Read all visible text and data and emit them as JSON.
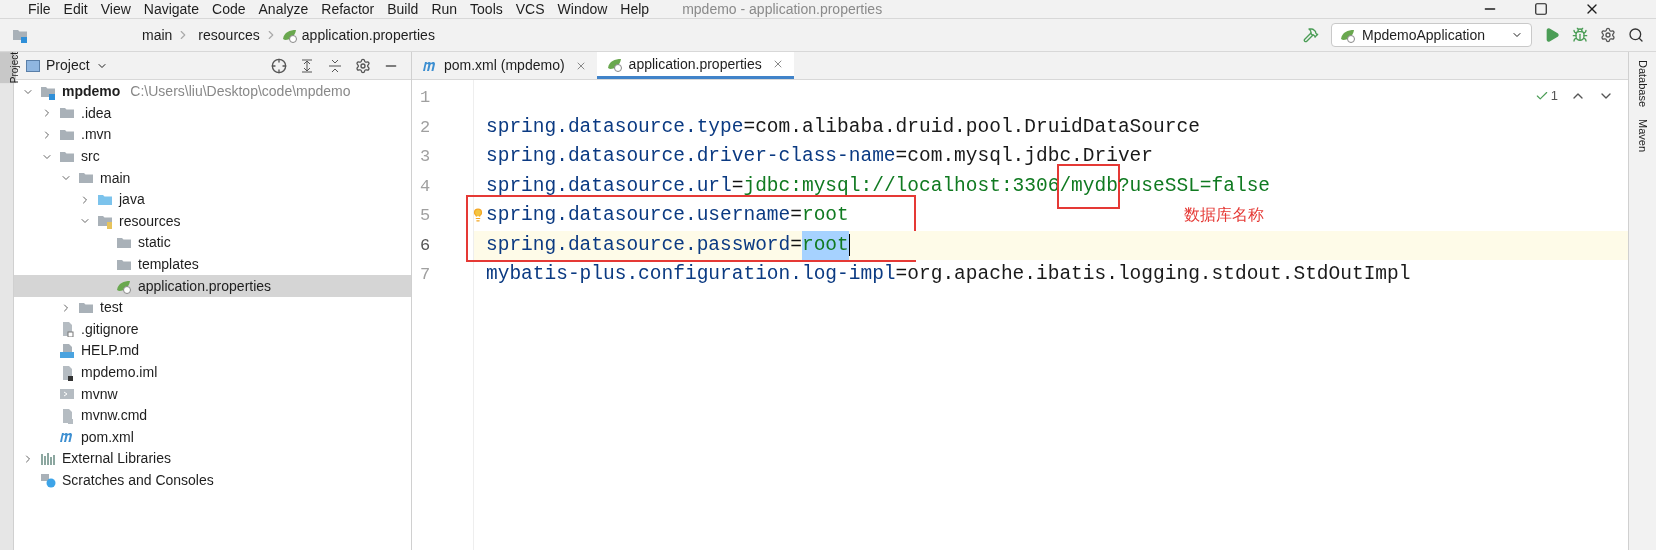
{
  "menu": [
    "File",
    "Edit",
    "View",
    "Navigate",
    "Code",
    "Analyze",
    "Refactor",
    "Build",
    "Run",
    "Tools",
    "VCS",
    "Window",
    "Help"
  ],
  "window": {
    "title": "mpdemo - application.properties"
  },
  "breadcrumbs": [
    "main",
    "resources",
    "application.properties"
  ],
  "run_config": {
    "label": "MpdemoApplication"
  },
  "left_strip": [
    {
      "label": "Project",
      "selected": true
    }
  ],
  "right_strip": [
    "Database",
    "Maven"
  ],
  "project_panel": {
    "title": "Project"
  },
  "tree": [
    {
      "name": "mpdemo",
      "path": "C:\\Users\\liu\\Desktop\\code\\mpdemo",
      "kind": "module",
      "expanded": true,
      "selected": false,
      "children": [
        {
          "name": ".idea",
          "kind": "folder",
          "expanded": false,
          "selected": false
        },
        {
          "name": ".mvn",
          "kind": "folder",
          "expanded": false,
          "selected": false
        },
        {
          "name": "src",
          "kind": "folder",
          "expanded": true,
          "selected": false,
          "children": [
            {
              "name": "main",
              "kind": "folder",
              "expanded": true,
              "selected": false,
              "children": [
                {
                  "name": "java",
                  "kind": "source",
                  "expanded": false,
                  "selected": false
                },
                {
                  "name": "resources",
                  "kind": "resources",
                  "expanded": true,
                  "selected": false,
                  "children": [
                    {
                      "name": "static",
                      "kind": "folder",
                      "selected": false
                    },
                    {
                      "name": "templates",
                      "kind": "folder",
                      "selected": false
                    },
                    {
                      "name": "application.properties",
                      "kind": "spring",
                      "selected": true
                    }
                  ]
                }
              ]
            },
            {
              "name": "test",
              "kind": "folder",
              "expanded": false,
              "selected": false
            }
          ]
        },
        {
          "name": ".gitignore",
          "kind": "ignore",
          "selected": false
        },
        {
          "name": "HELP.md",
          "kind": "md",
          "selected": false
        },
        {
          "name": "mpdemo.iml",
          "kind": "iml",
          "selected": false
        },
        {
          "name": "mvnw",
          "kind": "shell",
          "selected": false
        },
        {
          "name": "mvnw.cmd",
          "kind": "text",
          "selected": false
        },
        {
          "name": "pom.xml",
          "kind": "maven",
          "selected": false
        }
      ]
    },
    {
      "name": "External Libraries",
      "kind": "libraries",
      "expanded": false,
      "selected": false
    },
    {
      "name": "Scratches and Consoles",
      "kind": "scratches",
      "selected": false
    }
  ],
  "tabs": [
    {
      "label": "pom.xml (mpdemo)",
      "kind": "maven",
      "selected": false
    },
    {
      "label": "application.properties",
      "kind": "spring",
      "selected": true
    }
  ],
  "inspection": {
    "count": "1"
  },
  "lines": [
    {
      "number": "1",
      "current": false
    },
    {
      "number": "2",
      "current": false,
      "parts": [
        {
          "text": "spring.datasource.type",
          "kind": "key"
        },
        {
          "text": "=",
          "kind": "sep"
        },
        {
          "text": "com.alibaba.druid.pool.DruidDataSource",
          "kind": "ref"
        }
      ]
    },
    {
      "number": "3",
      "current": false,
      "parts": [
        {
          "text": "spring.datasource.driver-class-name",
          "kind": "key"
        },
        {
          "text": "=",
          "kind": "sep"
        },
        {
          "text": "com.mysql.jdbc.Driver",
          "kind": "ref"
        }
      ]
    },
    {
      "number": "4",
      "current": false,
      "parts": [
        {
          "text": "spring.datasource.url",
          "kind": "key"
        },
        {
          "text": "=",
          "kind": "sep"
        },
        {
          "text": "jdbc:mysql://localhost:3306",
          "kind": "value"
        },
        {
          "text": "/mydb",
          "kind": "value",
          "boxed": true
        },
        {
          "text": "?useSSL=false",
          "kind": "value"
        }
      ]
    },
    {
      "number": "5",
      "current": false,
      "bulb": true,
      "boxed": true,
      "parts": [
        {
          "text": "spring.datasource.username",
          "kind": "key"
        },
        {
          "text": "=",
          "kind": "sep"
        },
        {
          "text": "root",
          "kind": "value"
        }
      ]
    },
    {
      "number": "6",
      "current": true,
      "boxed": true,
      "parts": [
        {
          "text": "spring.datasource.password",
          "kind": "key"
        },
        {
          "text": "=",
          "kind": "sep"
        },
        {
          "text": "root",
          "kind": "value",
          "selected": true
        }
      ]
    },
    {
      "number": "7",
      "current": false,
      "parts": [
        {
          "text": "mybatis-plus.configuration.log-impl",
          "kind": "key"
        },
        {
          "text": "=",
          "kind": "sep"
        },
        {
          "text": "org.apache.ibatis.logging.stdout.StdOutImpl",
          "kind": "ref"
        }
      ]
    }
  ],
  "note": "数据库名称"
}
